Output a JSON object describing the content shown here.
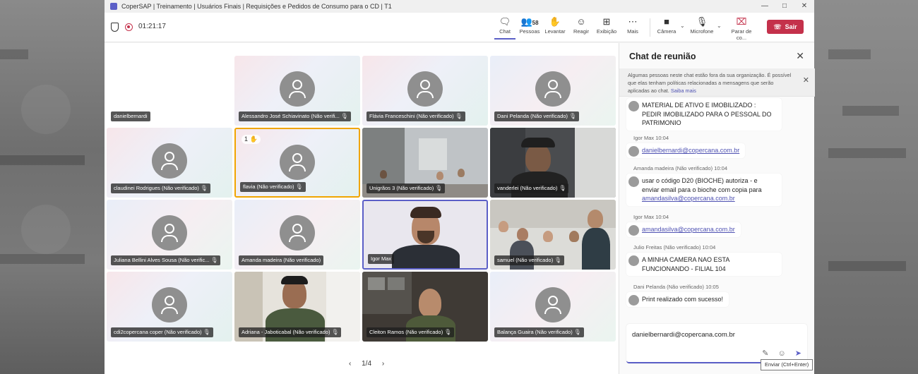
{
  "window": {
    "title": "CoperSAP | Treinamento | Usuários Finais | Requisições e Pedidos de Consumo para o CD | T1"
  },
  "toolbar": {
    "timer": "01:21:17",
    "people_count": "58",
    "buttons": [
      {
        "label": "Chat",
        "icon": "chat-icon"
      },
      {
        "label": "Pessoas",
        "icon": "people-icon"
      },
      {
        "label": "Levantar",
        "icon": "raise-hand-icon"
      },
      {
        "label": "Reagir",
        "icon": "react-icon"
      },
      {
        "label": "Exibição",
        "icon": "view-icon"
      },
      {
        "label": "Mais",
        "icon": "more-icon"
      },
      {
        "label": "Câmera",
        "icon": "camera-icon"
      },
      {
        "label": "Microfone",
        "icon": "microphone-icon"
      },
      {
        "label": "Parar de co...",
        "icon": "stop-share-icon"
      }
    ],
    "leave_label": "Sair"
  },
  "stage": {
    "tiles": [
      {
        "name": "danielbernardi",
        "muted": false,
        "video": false
      },
      {
        "name": "Alessandro José Schiavinato (Não verifi...",
        "muted": true,
        "video": false
      },
      {
        "name": "Flávia Franceschini (Não verificado)",
        "muted": true,
        "video": false
      },
      {
        "name": "Dani Pelanda (Não verificado)",
        "muted": true,
        "video": false
      },
      {
        "name": "claudinei Rodrigues (Não verificado)",
        "muted": true,
        "video": false
      },
      {
        "name": "flavia (Não verificado)",
        "muted": true,
        "video": false,
        "hand_raised": "1"
      },
      {
        "name": "Unigrãos 3 (Não verificado)",
        "muted": true,
        "video": true
      },
      {
        "name": "vanderlei (Não verificado)",
        "muted": true,
        "video": true
      },
      {
        "name": "Juliana Bellini Alves Sousa (Não verific...",
        "muted": true,
        "video": false
      },
      {
        "name": "Amanda madeira (Não verificado)",
        "muted": false,
        "video": false
      },
      {
        "name": "Igor Max",
        "muted": false,
        "video": true,
        "speaking": true
      },
      {
        "name": "samuel (Não verificado)",
        "muted": true,
        "video": true
      },
      {
        "name": "cdi2copercana coper (Não verificado)",
        "muted": true,
        "video": false
      },
      {
        "name": "Adriana - Jaboticabal (Não verificado)",
        "muted": true,
        "video": true
      },
      {
        "name": "Cleiton Ramos (Não verificado)",
        "muted": true,
        "video": true
      },
      {
        "name": "Balança Guaira (Não verificado)",
        "muted": true,
        "video": false
      }
    ],
    "pager": "1/4"
  },
  "chat": {
    "title": "Chat de reunião",
    "banner_text": "Algumas pessoas neste chat estão fora da sua organização. É possível que elas tenham políticas relacionadas a mensagens que serão aplicadas ao chat.",
    "banner_link": "Saiba mais",
    "messages": [
      {
        "meta": "",
        "text": "MATERIAL DE ATIVO E IMOBILIZADO : PEDIR IMOBILIZADO PARA O PESSOAL DO PATRIMONIO",
        "link": ""
      },
      {
        "meta": "Igor Max   10:04",
        "text": "",
        "link": "danielbernardi@copercana.com.br"
      },
      {
        "meta": "Amanda madeira (Não verificado)   10:04",
        "text": "usar o código D20 (BIOCHE) autoriza - e enviar email para o bioche com copia para",
        "link": "amandasilva@copercana.com.br"
      },
      {
        "meta": "Igor Max   10:04",
        "text": "",
        "link": "amandasilva@copercana.com.br"
      },
      {
        "meta": "Julio Freitas (Não verificado)   10:04",
        "text": "A MINHA CAMERA NAO ESTA FUNCIONANDO - FILIAL 104",
        "link": ""
      },
      {
        "meta": "Dani Pelanda (Não verificado)   10:05",
        "text": "Print realizado com sucesso!",
        "link": ""
      }
    ],
    "compose_value": "danielbernardi@copercana.com.br",
    "send_tooltip": "Enviar (Ctrl+Enter)"
  }
}
